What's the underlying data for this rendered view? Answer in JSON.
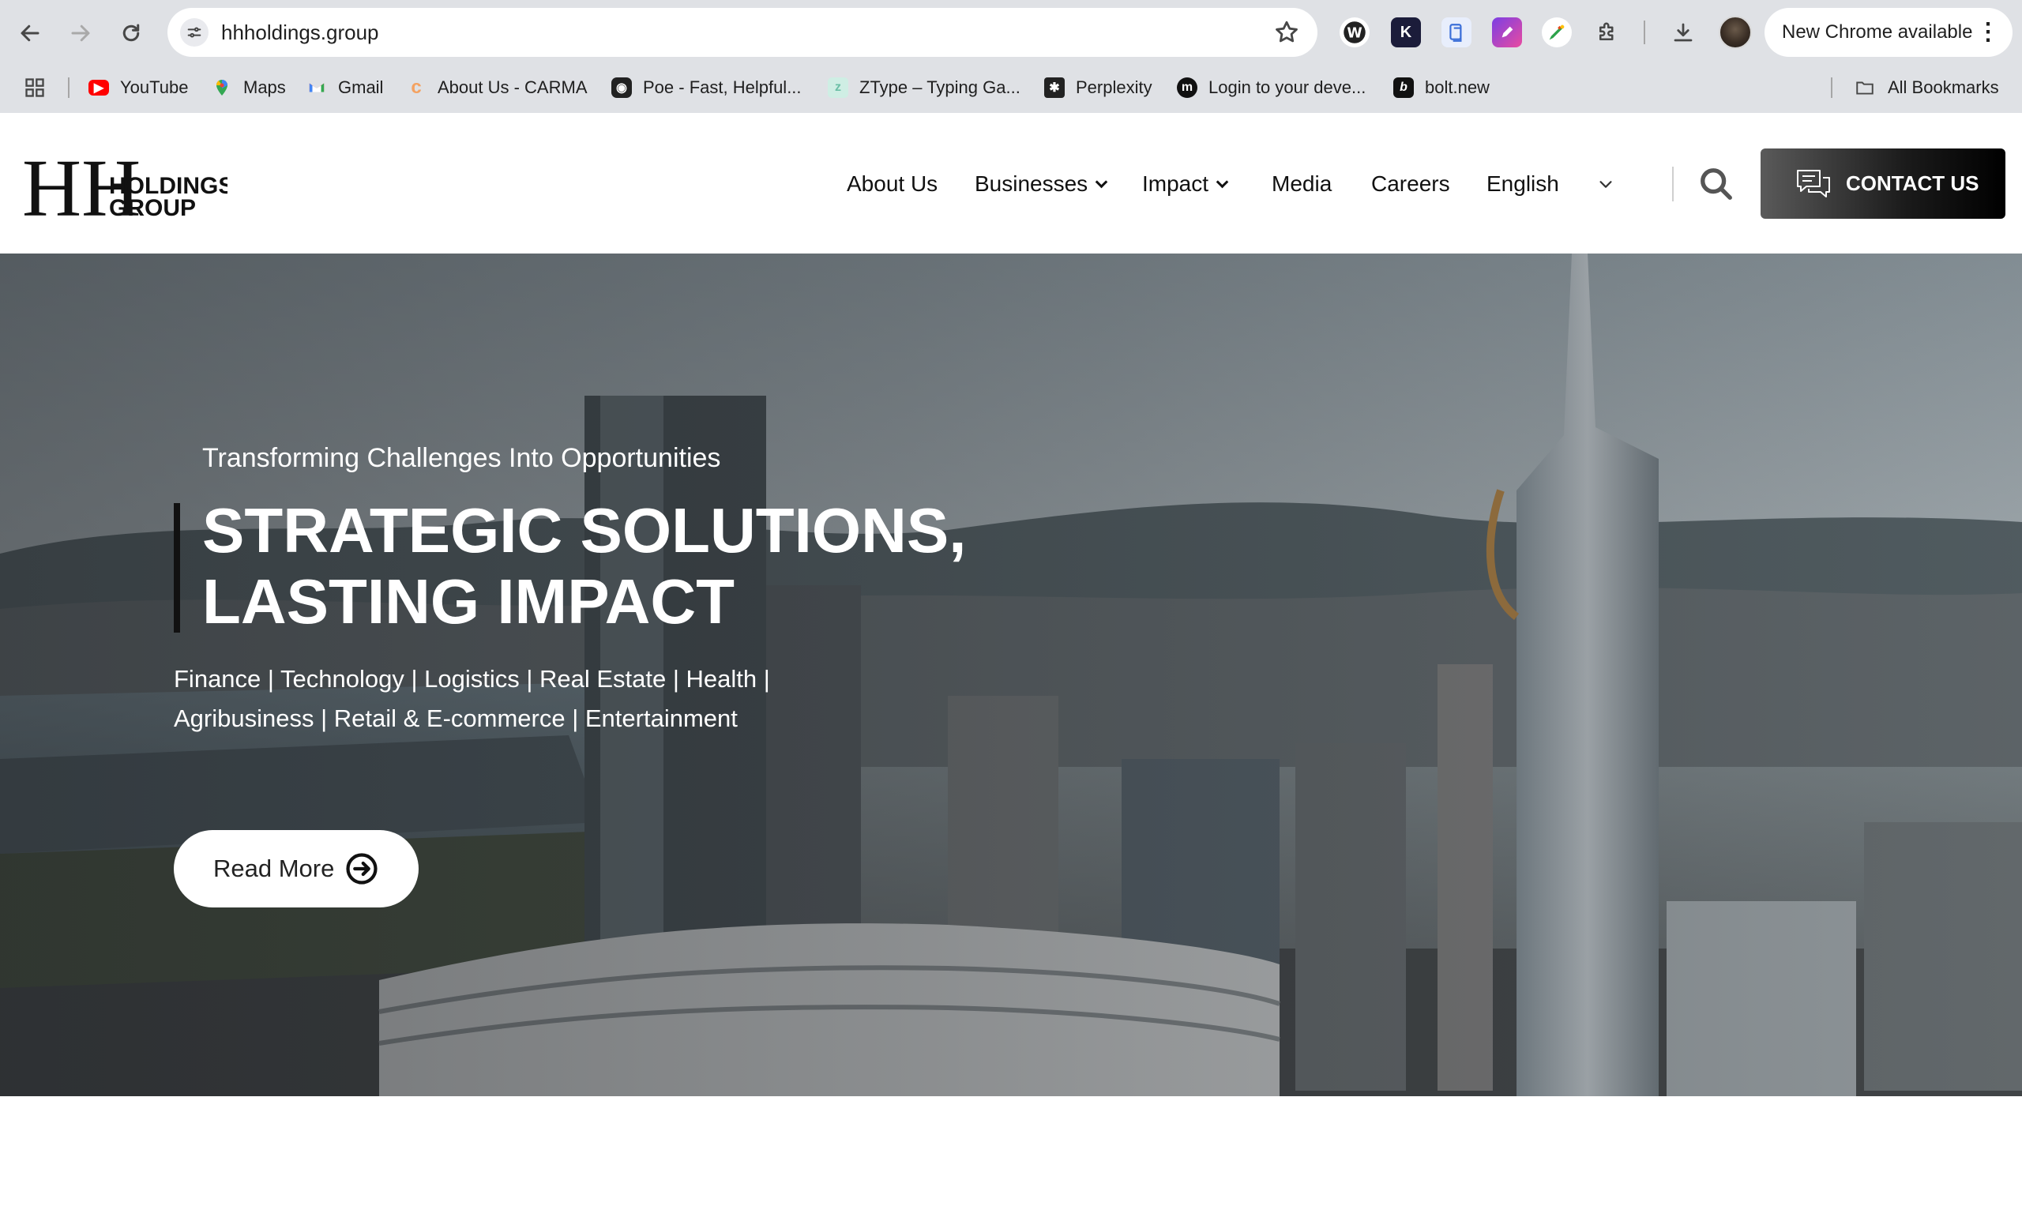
{
  "browser": {
    "url": "hhholdings.group",
    "update_label": "New Chrome available",
    "bookmarks": [
      {
        "label": "YouTube",
        "icon": "youtube-icon",
        "color": "#ff0000"
      },
      {
        "label": "Maps",
        "icon": "maps-icon",
        "color": "#34a853"
      },
      {
        "label": "Gmail",
        "icon": "gmail-icon",
        "color": "#ea4335"
      },
      {
        "label": "About Us - CARMA",
        "icon": "carma-icon",
        "color": "#f4a261"
      },
      {
        "label": "Poe - Fast, Helpful...",
        "icon": "poe-icon",
        "color": "#222222"
      },
      {
        "label": "ZType – Typing Ga...",
        "icon": "ztype-icon",
        "color": "#9fd8c8"
      },
      {
        "label": "Perplexity",
        "icon": "perplexity-icon",
        "color": "#222222"
      },
      {
        "label": "Login to your deve...",
        "icon": "medium-icon",
        "color": "#111111"
      },
      {
        "label": "bolt.new",
        "icon": "bolt-icon",
        "color": "#111111"
      }
    ],
    "all_bookmarks": "All Bookmarks"
  },
  "site": {
    "logo_letters": "HH",
    "logo_line1": "HOLDINGS",
    "logo_line2": "GROUP",
    "nav": {
      "about": "About Us",
      "businesses": "Businesses",
      "impact": "Impact",
      "media": "Media",
      "careers": "Careers",
      "language": "English"
    },
    "contact_label": "CONTACT US"
  },
  "hero": {
    "tagline": "Transforming Challenges Into Opportunities",
    "title": "STRATEGIC SOLUTIONS, LASTING IMPACT",
    "sectors_line1": "Finance | Technology | Logistics | Real Estate | Health |",
    "sectors_line2": "Agribusiness | Retail & E-commerce | Entertainment",
    "read_more": "Read More"
  }
}
